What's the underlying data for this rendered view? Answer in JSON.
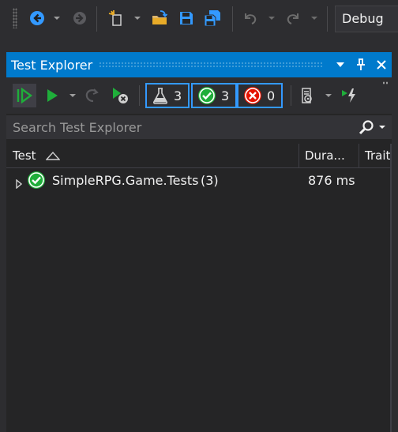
{
  "toolbar": {
    "icons": [
      "back-arrow-icon",
      "forward-arrow-icon",
      "new-project-icon",
      "open-folder-icon",
      "save-icon",
      "save-all-icon",
      "undo-icon",
      "redo-icon"
    ],
    "configuration": "Debug"
  },
  "panel": {
    "title": "Test Explorer",
    "accent_color": "#007acc"
  },
  "test_toolbar": {
    "total_count": "3",
    "passed_count": "3",
    "failed_count": "0",
    "pass_color": "#1fae3a",
    "fail_color": "#e51400"
  },
  "search": {
    "placeholder": "Search Test Explorer",
    "value": ""
  },
  "columns": [
    {
      "label": "Test"
    },
    {
      "label": "Dura..."
    },
    {
      "label": "Traits"
    }
  ],
  "tests": [
    {
      "name": "SimpleRPG.Game.Tests",
      "count": "(3)",
      "duration": "876 ms",
      "status": "passed"
    }
  ]
}
